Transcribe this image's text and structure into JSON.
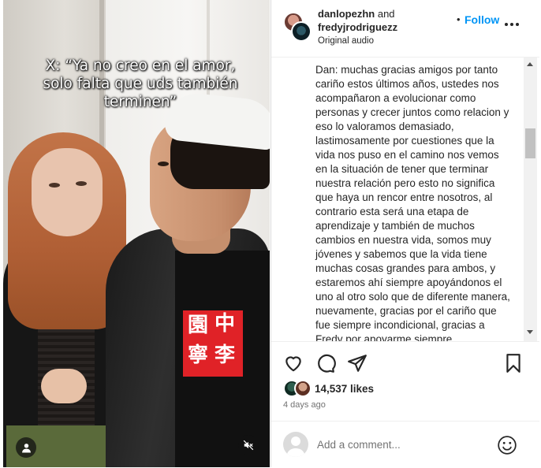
{
  "video": {
    "overlay_text": "X: “Ya no creo en el amor,\nsolo falta que uds también\nterminen”",
    "shirt_print": [
      "園",
      "中",
      "寧",
      "李"
    ]
  },
  "post": {
    "users": [
      "danlopezhn",
      "fredyjrodriguezz"
    ],
    "and_word": "and",
    "follow_label": "Follow",
    "audio": "Original audio",
    "caption": "Dan: muchas gracias amigos por tanto cariño estos últimos años, ustedes nos acompañaron a evolucionar como personas y crecer juntos como relacion y eso lo valoramos demasiado, lastimosamente por cuestiones que la vida nos puso en el camino nos vemos en la situación de tener que terminar nuestra relación pero esto no significa que haya un rencor entre nosotros, al contrario esta será una etapa de aprendizaje y también de muchos cambios en nuestra vida, somos muy jóvenes y sabemos que la vida tiene muchas cosas grandes para ambos, y estaremos ahí siempre apoyándonos el uno al otro solo que de diferente manera, nuevamente, gracias por el cariño que fue siempre incondicional, gracias a Fredy por apoyarme siempre",
    "likes": "14,537 likes",
    "time_ago": "4 days ago"
  },
  "comment": {
    "placeholder": "Add a comment..."
  },
  "icons": {
    "like": "heart-icon",
    "comment": "comment-bubble-icon",
    "share": "paper-plane-icon",
    "save": "bookmark-icon",
    "mute": "speaker-muted-icon",
    "tags": "user-icon",
    "menu": "more-options-icon",
    "emoji": "emoji-icon"
  },
  "colors": {
    "follow": "#0095f6",
    "text": "#262626",
    "secondary": "#737373",
    "divider": "#efefef"
  }
}
